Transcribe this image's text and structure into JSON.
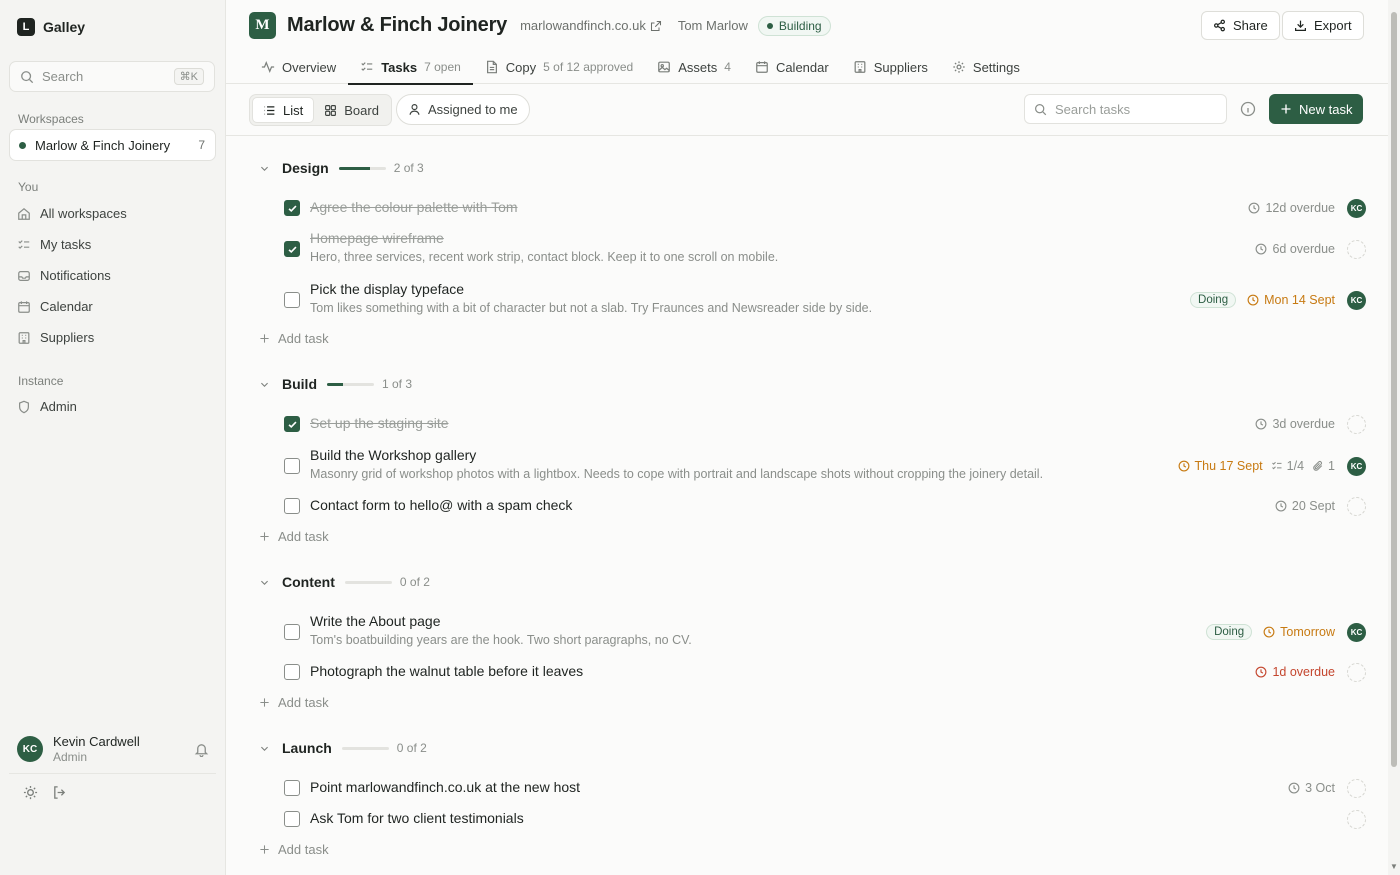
{
  "app": {
    "logo_letter": "L",
    "name": "Galley"
  },
  "search": {
    "placeholder": "Search",
    "shortcut": "⌘K"
  },
  "sidebar": {
    "workspaces_label": "Workspaces",
    "workspace": {
      "name": "Marlow & Finch Joinery",
      "count": "7"
    },
    "you_label": "You",
    "you_items": [
      {
        "label": "All workspaces",
        "icon": "home-icon"
      },
      {
        "label": "My tasks",
        "icon": "list-check-icon"
      },
      {
        "label": "Notifications",
        "icon": "inbox-icon"
      },
      {
        "label": "Calendar",
        "icon": "calendar-icon"
      },
      {
        "label": "Suppliers",
        "icon": "building-icon"
      }
    ],
    "instance_label": "Instance",
    "instance_items": [
      {
        "label": "Admin",
        "icon": "shield-icon"
      }
    ]
  },
  "user": {
    "initials": "KC",
    "name": "Kevin Cardwell",
    "role": "Admin"
  },
  "header": {
    "badge": "M",
    "title": "Marlow & Finch Joinery",
    "domain": "marlowandfinch.co.uk",
    "owner": "Tom Marlow",
    "status": "Building",
    "share_label": "Share",
    "export_label": "Export"
  },
  "tabs": [
    {
      "label": "Overview",
      "meta": ""
    },
    {
      "label": "Tasks",
      "meta": "7 open"
    },
    {
      "label": "Copy",
      "meta": "5 of 12 approved"
    },
    {
      "label": "Assets",
      "meta": "4"
    },
    {
      "label": "Calendar",
      "meta": ""
    },
    {
      "label": "Suppliers",
      "meta": ""
    },
    {
      "label": "Settings",
      "meta": ""
    }
  ],
  "toolbar": {
    "list_label": "List",
    "board_label": "Board",
    "assigned_label": "Assigned to me",
    "search_placeholder": "Search tasks",
    "new_task_label": "New task"
  },
  "sections": [
    {
      "title": "Design",
      "count": "2 of 3",
      "progress": 0.67,
      "tasks": [
        {
          "title": "Agree the colour palette with Tom",
          "done": true,
          "desc": "",
          "status": "",
          "due": "12d overdue",
          "due_tone": "muted",
          "assignee": "KC"
        },
        {
          "title": "Homepage wireframe",
          "done": true,
          "desc": "Hero, three services, recent work strip, contact block. Keep it to one scroll on mobile.",
          "status": "",
          "due": "6d overdue",
          "due_tone": "muted",
          "assignee": ""
        },
        {
          "title": "Pick the display typeface",
          "done": false,
          "desc": "Tom likes something with a bit of character but not a slab. Try Fraunces and Newsreader side by side.",
          "status": "Doing",
          "due": "Mon 14 Sept",
          "due_tone": "orange",
          "assignee": "KC"
        }
      ],
      "add_label": "Add task"
    },
    {
      "title": "Build",
      "count": "1 of 3",
      "progress": 0.33,
      "tasks": [
        {
          "title": "Set up the staging site",
          "done": true,
          "desc": "",
          "status": "",
          "due": "3d overdue",
          "due_tone": "muted",
          "assignee": ""
        },
        {
          "title": "Build the Workshop gallery",
          "done": false,
          "desc": "Masonry grid of workshop photos with a lightbox. Needs to cope with portrait and landscape shots without cropping the joinery detail.",
          "status": "",
          "due": "Thu 17 Sept",
          "due_tone": "orange",
          "subtasks": "1/4",
          "attachments": "1",
          "assignee": "KC"
        },
        {
          "title": "Contact form to hello@ with a spam check",
          "done": false,
          "desc": "",
          "status": "",
          "due": "20 Sept",
          "due_tone": "muted",
          "assignee": ""
        }
      ],
      "add_label": "Add task"
    },
    {
      "title": "Content",
      "count": "0 of 2",
      "progress": 0,
      "tasks": [
        {
          "title": "Write the About page",
          "done": false,
          "desc": "Tom's boatbuilding years are the hook. Two short paragraphs, no CV.",
          "status": "Doing",
          "due": "Tomorrow",
          "due_tone": "orange",
          "assignee": "KC"
        },
        {
          "title": "Photograph the walnut table before it leaves",
          "done": false,
          "desc": "",
          "status": "",
          "due": "1d overdue",
          "due_tone": "red",
          "assignee": ""
        }
      ],
      "add_label": "Add task"
    },
    {
      "title": "Launch",
      "count": "0 of 2",
      "progress": 0,
      "tasks": [
        {
          "title": "Point marlowandfinch.co.uk at the new host",
          "done": false,
          "desc": "",
          "status": "",
          "due": "3 Oct",
          "due_tone": "muted",
          "assignee": ""
        },
        {
          "title": "Ask Tom for two client testimonials",
          "done": false,
          "desc": "",
          "status": "",
          "due": "",
          "due_tone": "muted",
          "assignee": ""
        }
      ],
      "add_label": "Add task"
    }
  ],
  "colors": {
    "accent": "#2d5e44",
    "overdue_orange": "#c77a12",
    "overdue_red": "#c4462e"
  }
}
